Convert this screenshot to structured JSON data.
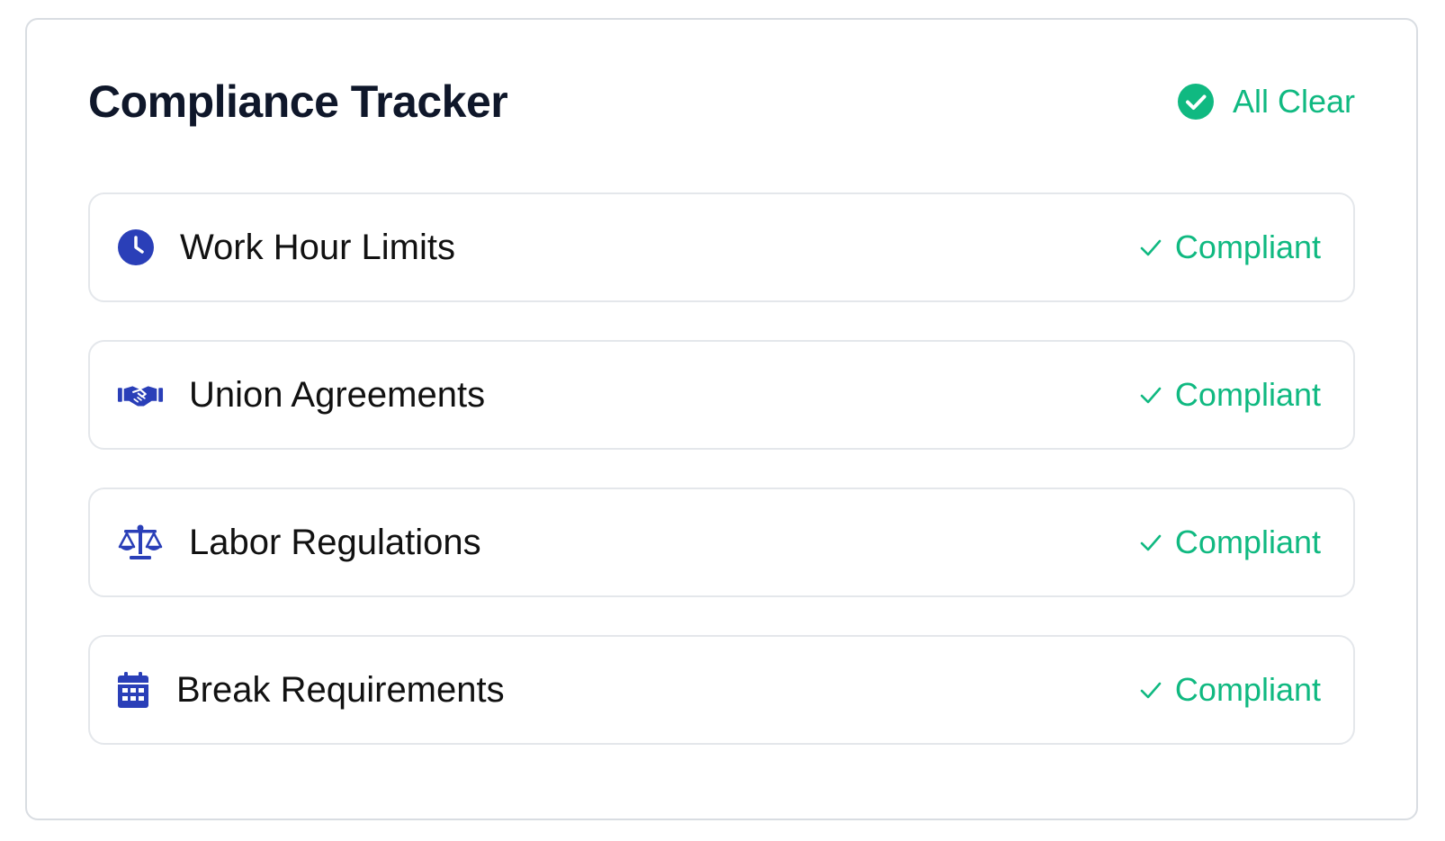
{
  "card": {
    "title": "Compliance Tracker",
    "status": {
      "label": "All Clear",
      "icon": "check-circle-icon",
      "color": "#10b981"
    }
  },
  "items": [
    {
      "label": "Work Hour Limits",
      "icon": "clock-icon",
      "status": "Compliant"
    },
    {
      "label": "Union Agreements",
      "icon": "handshake-icon",
      "status": "Compliant"
    },
    {
      "label": "Labor Regulations",
      "icon": "scale-icon",
      "status": "Compliant"
    },
    {
      "label": "Break Requirements",
      "icon": "calendar-icon",
      "status": "Compliant"
    }
  ],
  "colors": {
    "accent": "#2a3fb8",
    "success": "#10b981",
    "title": "#0f172a"
  }
}
